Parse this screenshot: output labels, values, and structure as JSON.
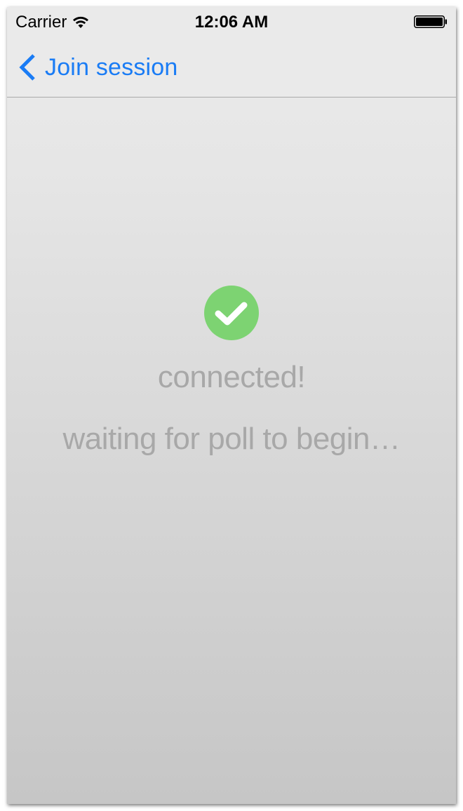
{
  "status_bar": {
    "carrier": "Carrier",
    "time": "12:06 AM",
    "wifi_icon": "wifi-icon",
    "battery_icon": "battery-icon"
  },
  "nav": {
    "back_icon": "chevron-left-icon",
    "back_label": "Join session"
  },
  "main": {
    "status_icon": "checkmark-circle-icon",
    "status_icon_color": "#7dd372",
    "connected_label": "connected!",
    "waiting_label": "waiting for poll to begin…"
  },
  "colors": {
    "accent": "#1a7cf5",
    "text_muted": "#a8a8a8"
  }
}
